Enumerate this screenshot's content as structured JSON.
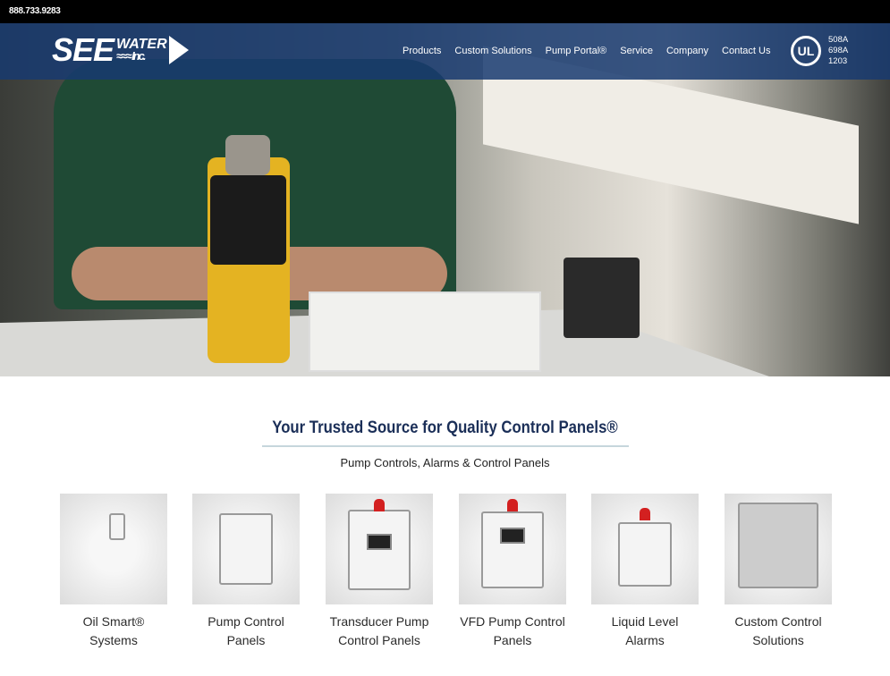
{
  "topbar": {
    "phone": "888.733.9283"
  },
  "header": {
    "logo": "SEE WATER Inc.",
    "nav": [
      "Products",
      "Custom Solutions",
      "Pump Portal®",
      "Service",
      "Company",
      "Contact Us"
    ],
    "ul_mark": "UL",
    "ul_codes": [
      "508A",
      "698A",
      "1203"
    ]
  },
  "main": {
    "title": "Your Trusted Source for Quality Control Panels®",
    "subtitle": "Pump Controls, Alarms & Control Panels",
    "products": [
      {
        "line1": "Oil Smart®",
        "line2": "Systems"
      },
      {
        "line1": "Pump Control",
        "line2": "Panels"
      },
      {
        "line1": "Transducer Pump",
        "line2": "Control Panels"
      },
      {
        "line1": "VFD Pump Control",
        "line2": "Panels"
      },
      {
        "line1": "Liquid Level",
        "line2": "Alarms"
      },
      {
        "line1": "Custom Control",
        "line2": "Solutions"
      }
    ]
  },
  "colors": {
    "nav": "#183a70",
    "title": "#1b2f58"
  }
}
